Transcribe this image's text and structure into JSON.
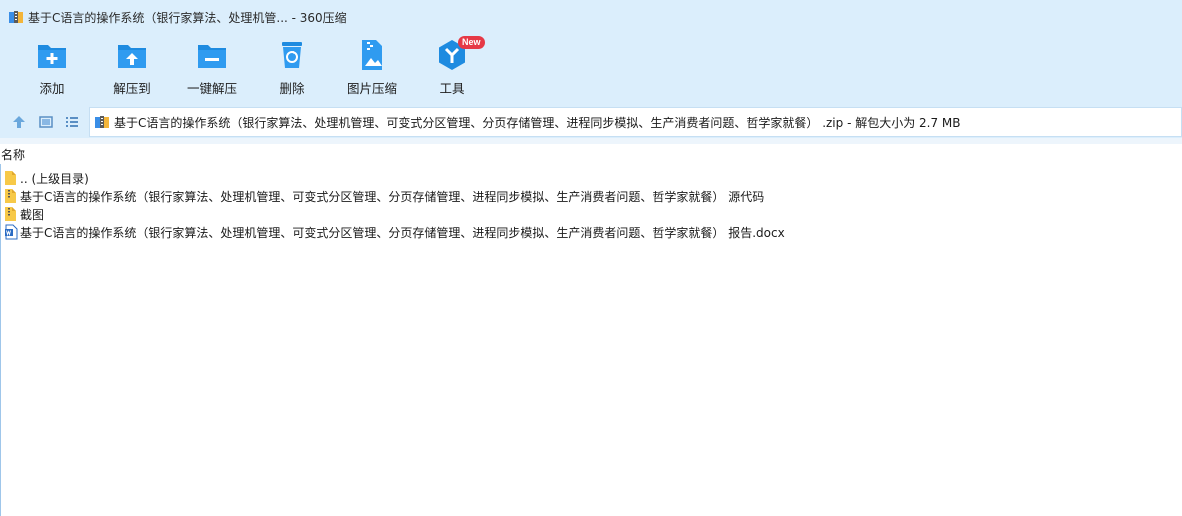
{
  "window": {
    "title": "基于C语言的操作系统（银行家算法、处理机管... - 360压缩",
    "app_icon": "archive-app-icon"
  },
  "toolbar": {
    "buttons": [
      {
        "label": "添加",
        "icon": "add-folder-icon"
      },
      {
        "label": "解压到",
        "icon": "extract-to-icon"
      },
      {
        "label": "一键解压",
        "icon": "one-click-extract-icon"
      },
      {
        "label": "删除",
        "icon": "trash-icon"
      },
      {
        "label": "图片压缩",
        "icon": "image-compress-icon"
      },
      {
        "label": "工具",
        "icon": "tools-icon",
        "badge": "New"
      }
    ]
  },
  "address": {
    "path_text": "基于C语言的操作系统（银行家算法、处理机管理、可变式分区管理、分页存储管理、进程同步模拟、生产消费者问题、哲学家就餐） .zip - 解包大小为 2.7 MB"
  },
  "filelist": {
    "column_header": "名称",
    "items": [
      {
        "name": ".. (上级目录)",
        "icon": "folder-icon"
      },
      {
        "name": "基于C语言的操作系统（银行家算法、处理机管理、可变式分区管理、分页存储管理、进程同步模拟、生产消费者问题、哲学家就餐） 源代码",
        "icon": "zipped-folder-icon"
      },
      {
        "name": "截图",
        "icon": "zipped-folder-icon"
      },
      {
        "name": "基于C语言的操作系统（银行家算法、处理机管理、可变式分区管理、分页存储管理、进程同步模拟、生产消费者问题、哲学家就餐） 报告.docx",
        "icon": "word-doc-icon"
      }
    ]
  },
  "colors": {
    "toolbar_bg": "#dbeefc",
    "icon_blue": "#1e8be0",
    "badge_red": "#e63946",
    "folder_yellow": "#f7c948"
  }
}
